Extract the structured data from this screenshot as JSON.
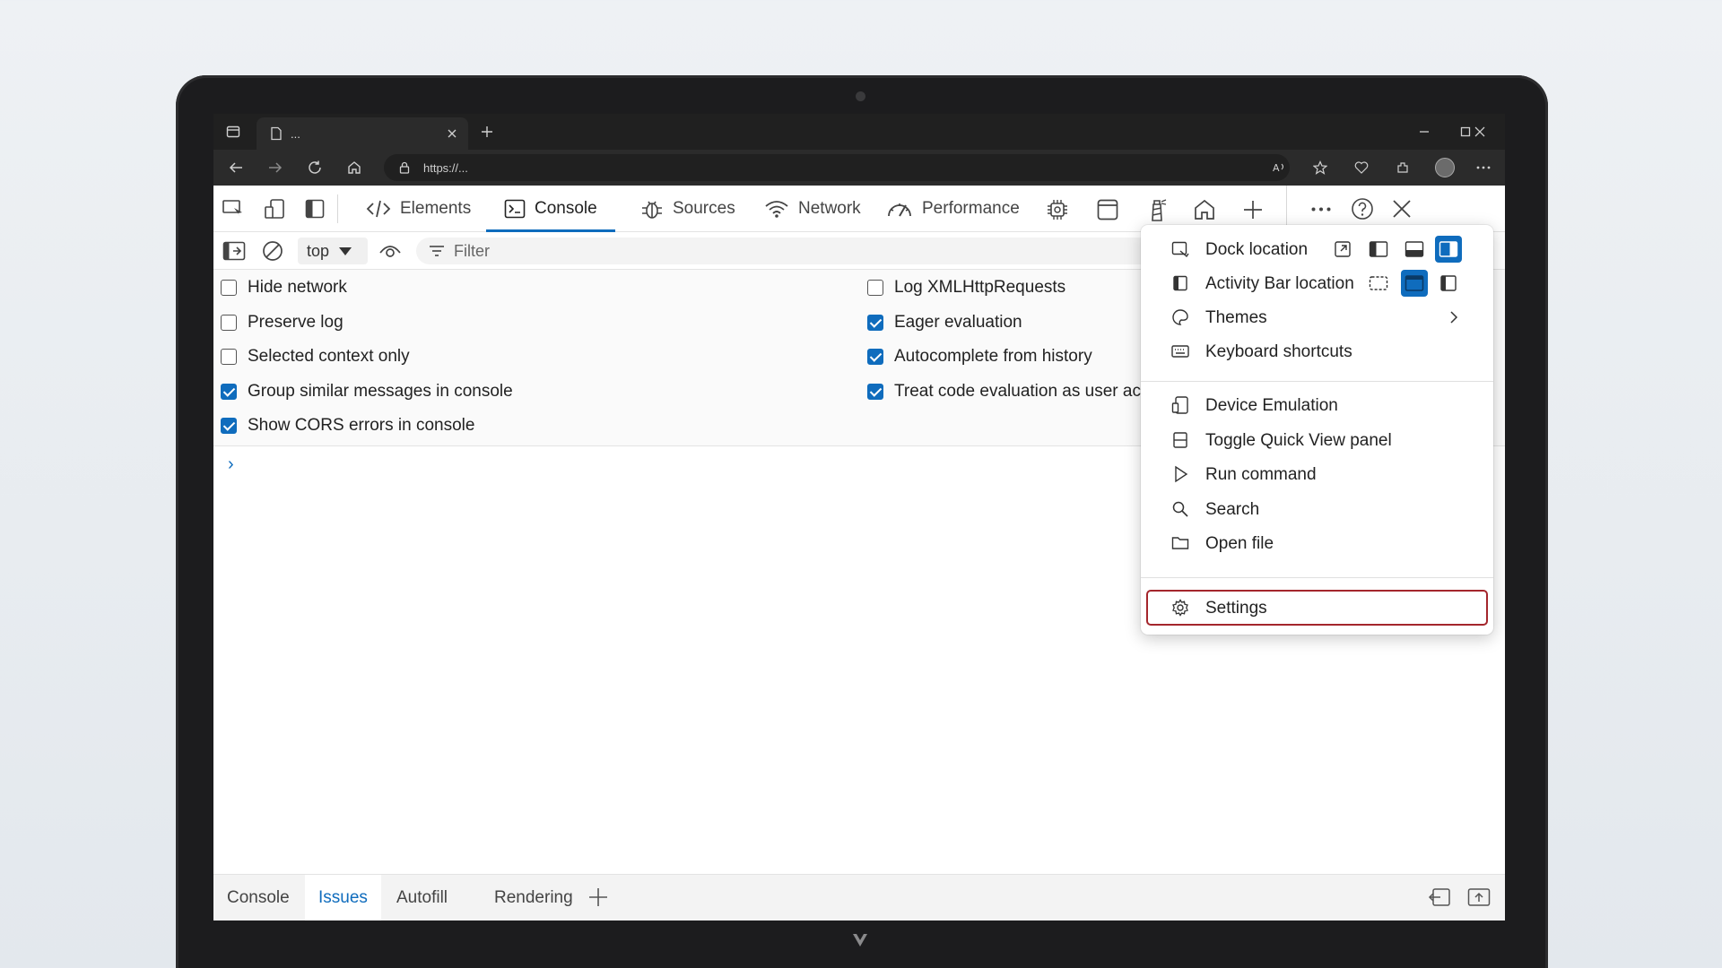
{
  "browser": {
    "tab_title": "...",
    "url": "https://..."
  },
  "devtools": {
    "tabs": [
      {
        "label": "Elements"
      },
      {
        "label": "Console"
      },
      {
        "label": "Sources"
      },
      {
        "label": "Network"
      },
      {
        "label": "Performance"
      }
    ],
    "active_tab": "Console",
    "context_select": "top",
    "filter_placeholder": "Filter",
    "options_left": [
      {
        "label": "Hide network",
        "checked": false
      },
      {
        "label": "Preserve log",
        "checked": false
      },
      {
        "label": "Selected context only",
        "checked": false
      },
      {
        "label": "Group similar messages in console",
        "checked": true
      },
      {
        "label": "Show CORS errors in console",
        "checked": true
      }
    ],
    "options_right": [
      {
        "label": "Log XMLHttpRequests",
        "checked": false
      },
      {
        "label": "Eager evaluation",
        "checked": true
      },
      {
        "label": "Autocomplete from history",
        "checked": true
      },
      {
        "label": "Treat code evaluation as user act",
        "checked": true
      }
    ],
    "prompt": "›"
  },
  "menu": {
    "items": [
      {
        "label": "Dock location",
        "icon": "dock-icon"
      },
      {
        "label": "Activity Bar location",
        "icon": "activity-bar-icon"
      },
      {
        "label": "Themes",
        "icon": "themes-icon"
      },
      {
        "label": "Keyboard shortcuts",
        "icon": "keyboard-icon"
      },
      {
        "label": "Device Emulation",
        "icon": "device-icon"
      },
      {
        "label": "Toggle Quick View panel",
        "icon": "quick-view-icon"
      },
      {
        "label": "Run command",
        "icon": "play-icon"
      },
      {
        "label": "Search",
        "icon": "search-icon"
      },
      {
        "label": "Open file",
        "icon": "folder-icon"
      },
      {
        "label": "Settings",
        "icon": "gear-icon"
      }
    ],
    "highlight_color": "#a4262c"
  },
  "drawer": {
    "tabs": [
      {
        "label": "Console"
      },
      {
        "label": "Issues"
      },
      {
        "label": "Autofill"
      },
      {
        "label": "Rendering"
      }
    ],
    "active_tab": "Issues"
  },
  "colors": {
    "accent": "#0f6cbd"
  }
}
